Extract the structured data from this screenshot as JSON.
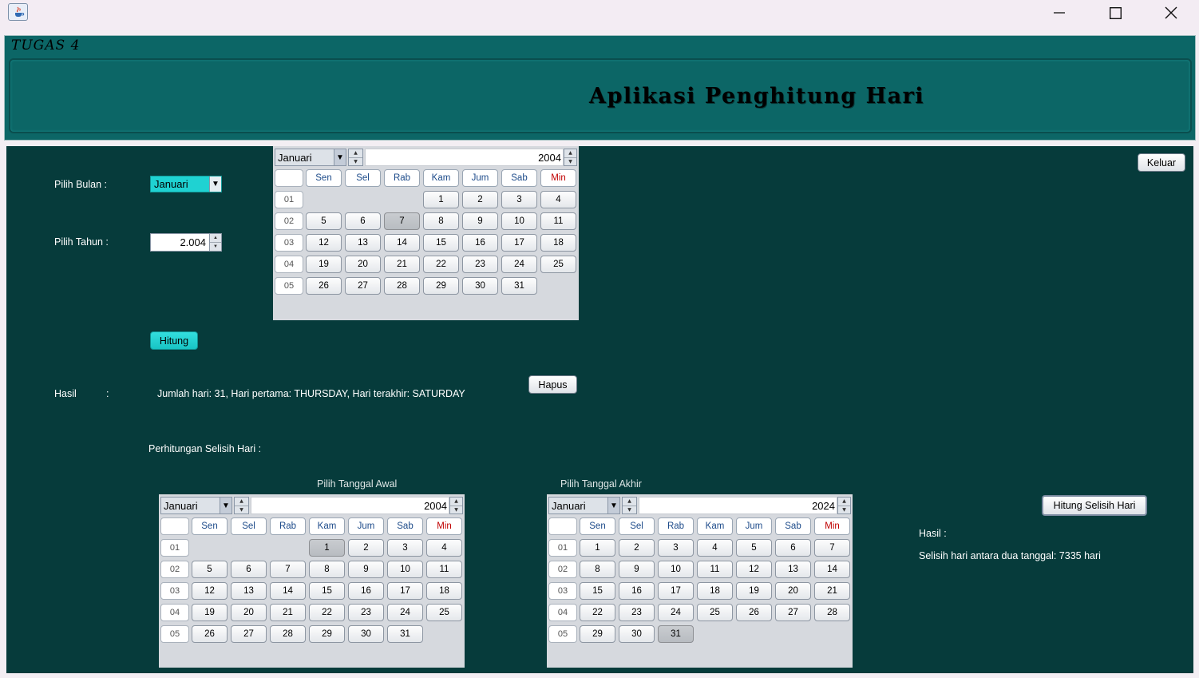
{
  "window": {
    "minimize_glyph": "—",
    "maximize_glyph": "☐",
    "close_glyph": "✕"
  },
  "header": {
    "small_title": "TUGAS 4",
    "title": "Aplikasi Penghitung Hari"
  },
  "form": {
    "pilih_bulan_label": "Pilih Bulan    :",
    "bulan_value": "Januari",
    "pilih_tahun_label": "Pilih Tahun    :",
    "tahun_value": "2.004",
    "hitung_label": "Hitung",
    "hasil_label": "Hasil",
    "hasil_colon": ":",
    "hasil_text": "Jumlah hari: 31, Hari pertama: THURSDAY, Hari terakhir: SATURDAY",
    "hapus_label": "Hapus",
    "keluar_label": "Keluar"
  },
  "selisih": {
    "section_label": "Perhitungan Selisih Hari :",
    "awal_label": "Pilih Tanggal Awal",
    "akhir_label": "Pilih Tanggal Akhir",
    "button_label": "Hitung Selisih Hari",
    "hasil_label": "Hasil :",
    "hasil_text": "Selisih hari antara dua tanggal: 7335 hari"
  },
  "day_names": [
    "Sen",
    "Sel",
    "Rab",
    "Kam",
    "Jum",
    "Sab",
    "Min"
  ],
  "calendars": {
    "top": {
      "month": "Januari",
      "year": "2004",
      "selected": "7",
      "rows": [
        {
          "week": "01",
          "days": [
            "",
            "",
            "",
            "1",
            "2",
            "3",
            "4"
          ]
        },
        {
          "week": "02",
          "days": [
            "5",
            "6",
            "7",
            "8",
            "9",
            "10",
            "11"
          ]
        },
        {
          "week": "03",
          "days": [
            "12",
            "13",
            "14",
            "15",
            "16",
            "17",
            "18"
          ]
        },
        {
          "week": "04",
          "days": [
            "19",
            "20",
            "21",
            "22",
            "23",
            "24",
            "25"
          ]
        },
        {
          "week": "05",
          "days": [
            "26",
            "27",
            "28",
            "29",
            "30",
            "31",
            ""
          ]
        }
      ]
    },
    "awal": {
      "month": "Januari",
      "year": "2004",
      "selected": "1",
      "rows": [
        {
          "week": "01",
          "days": [
            "",
            "",
            "",
            "1",
            "2",
            "3",
            "4"
          ]
        },
        {
          "week": "02",
          "days": [
            "5",
            "6",
            "7",
            "8",
            "9",
            "10",
            "11"
          ]
        },
        {
          "week": "03",
          "days": [
            "12",
            "13",
            "14",
            "15",
            "16",
            "17",
            "18"
          ]
        },
        {
          "week": "04",
          "days": [
            "19",
            "20",
            "21",
            "22",
            "23",
            "24",
            "25"
          ]
        },
        {
          "week": "05",
          "days": [
            "26",
            "27",
            "28",
            "29",
            "30",
            "31",
            ""
          ]
        }
      ]
    },
    "akhir": {
      "month": "Januari",
      "year": "2024",
      "selected": "31",
      "rows": [
        {
          "week": "01",
          "days": [
            "1",
            "2",
            "3",
            "4",
            "5",
            "6",
            "7"
          ]
        },
        {
          "week": "02",
          "days": [
            "8",
            "9",
            "10",
            "11",
            "12",
            "13",
            "14"
          ]
        },
        {
          "week": "03",
          "days": [
            "15",
            "16",
            "17",
            "18",
            "19",
            "20",
            "21"
          ]
        },
        {
          "week": "04",
          "days": [
            "22",
            "23",
            "24",
            "25",
            "26",
            "27",
            "28"
          ]
        },
        {
          "week": "05",
          "days": [
            "29",
            "30",
            "31",
            "",
            "",
            "",
            ""
          ]
        }
      ]
    }
  }
}
